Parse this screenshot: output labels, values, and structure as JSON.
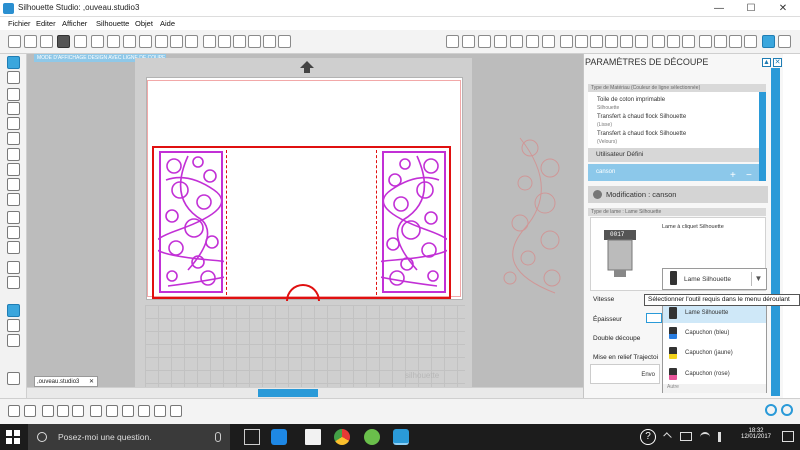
{
  "titlebar": {
    "title": "Silhouette Studio: ,ouveau.studio3",
    "min": "—",
    "max": "☐",
    "close": "✕"
  },
  "menus": [
    "Fichier",
    "Editer",
    "Afficher",
    "Silhouette",
    "Objet",
    "Aide"
  ],
  "canvas": {
    "mode_label": "MODE D'AFFICHAGE DESIGN AVEC LIGNE DE COUPE",
    "doc_tab": ",ouveau.studio3",
    "doc_tab_close": "✕",
    "watermark": "silhouette"
  },
  "panel": {
    "title": "PARAMÈTRES DE DÉCOUPE",
    "material_header": "Type de Matériau (Couleur de ligne sélectionnée)",
    "materials": [
      {
        "name": "Toile de coton imprimable",
        "sub": "Silhouette"
      },
      {
        "name": "Transfert à chaud flock Silhouette",
        "sub": "(Lisse)"
      },
      {
        "name": "Transfert à chaud flock Silhouette",
        "sub": "(Velours)"
      }
    ],
    "user_defined": "Utilisateur Défini",
    "selected_material": "canson",
    "add": "+",
    "remove": "−",
    "modification": "Modification : canson",
    "blade_type_header": "Type de lame : Lame Silhouette",
    "blade_name": "Lame à cliquet Silhouette",
    "blade_counter": "0017",
    "dropdown_value": "Lame Silhouette",
    "vitesse": "Vitesse",
    "epaisseur": "Épaisseur",
    "double": "Double découpe",
    "relief": "Mise en relief Trajectoi",
    "envoyer": "Envo",
    "tooltip": "Sélectionner l'outil requis dans le menu déroulant",
    "options": [
      "Lame Silhouette",
      "Capuchon (bleu)",
      "Capuchon (jaune)",
      "Capuchon (rose)"
    ],
    "option_autre": "Autre"
  },
  "taskbar": {
    "search": "Posez-moi une question.",
    "time": "18:32",
    "date": "12/01/2017"
  }
}
